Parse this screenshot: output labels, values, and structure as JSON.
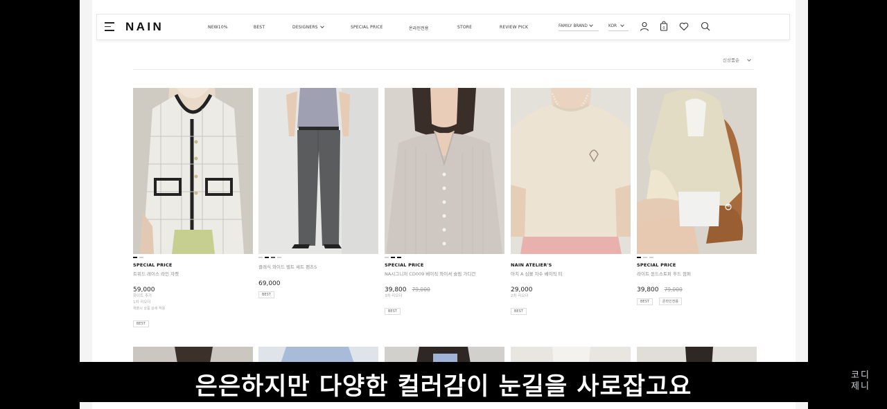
{
  "header": {
    "logo": "NAIN",
    "nav": [
      "NEW10%",
      "BEST",
      "DESIGNERS",
      "SPECIAL PRICE",
      "온라인전용",
      "STORE",
      "REVIEW PICK"
    ],
    "family_brand": "FAMILY BRAND",
    "language": "KOR",
    "icons": [
      "menu-icon",
      "user-icon",
      "bag-icon",
      "heart-icon",
      "search-icon"
    ]
  },
  "sort": {
    "label": "신상품순"
  },
  "products": [
    {
      "label": "SPECIAL PRICE",
      "name": "트위드 레이스 라인 자켓",
      "price": "59,000",
      "original_price": "",
      "meta": [
        "화이트 추가",
        "1차 리오더",
        "재출시 상품 상세 적용"
      ],
      "badges": [
        "BEST"
      ]
    },
    {
      "label": "",
      "name": "클래식 와이드 벨트 세트 팬츠S",
      "price": "69,000",
      "original_price": "",
      "meta": [],
      "badges": [
        "BEST"
      ]
    },
    {
      "label": "SPECIAL PRICE",
      "name": "NA시그니처 CD009 베이직 와이셔 슬림 가디건",
      "price": "39,800",
      "original_price": "79,000",
      "meta": [
        "3차 리오더"
      ],
      "badges": [
        "BEST"
      ]
    },
    {
      "label": "NAIN ATELIER'S",
      "name": "아치 A 심볼 자수 베이직 티",
      "price": "29,000",
      "original_price": "",
      "meta": [
        "2차 리오더"
      ],
      "badges": [
        "BEST"
      ]
    },
    {
      "label": "SPECIAL PRICE",
      "name": "라이트 윈드스토퍼 후드 점퍼",
      "price": "39,800",
      "original_price": "79,000",
      "meta": [],
      "badges": [
        "BEST",
        "온라인전용"
      ]
    }
  ],
  "subtitle": "은은하지만 다양한 컬러감이 눈길을 사로잡고요",
  "watermark": [
    "코디",
    "제니"
  ]
}
